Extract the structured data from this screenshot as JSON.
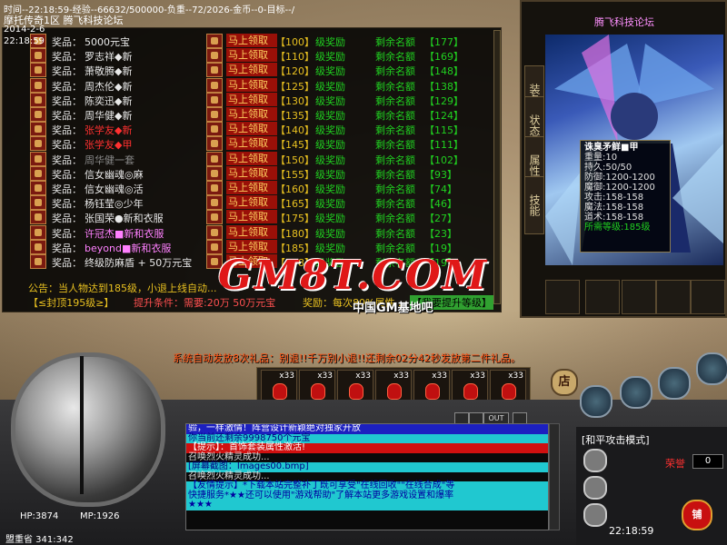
{
  "topbar": {
    "status": "时间--22:18:59-经验--66632/500000-负重--72/2026-金币--0-目标--/",
    "server": "摩托传奇1区 腾飞科技论坛",
    "date": "2014-2-6",
    "time": "22:18:59"
  },
  "reward": {
    "prize_label": "奖品：",
    "claim_label": "马上领取",
    "level_label": "级奖励",
    "remain_label": "剩余名额",
    "rows": [
      {
        "prize": "5000元宝",
        "style": "",
        "level": "【100】",
        "remain": "【177】"
      },
      {
        "prize": "罗志祥◆新",
        "style": "",
        "level": "【110】",
        "remain": "【169】"
      },
      {
        "prize": "萧敬腾◆新",
        "style": "",
        "level": "【120】",
        "remain": "【148】"
      },
      {
        "prize": "周杰伦◆新",
        "style": "",
        "level": "【125】",
        "remain": "【138】"
      },
      {
        "prize": "陈奕迅◆新",
        "style": "",
        "level": "【130】",
        "remain": "【129】"
      },
      {
        "prize": "周华健◆新",
        "style": "",
        "level": "【135】",
        "remain": "【124】"
      },
      {
        "prize": "张学友◆新",
        "style": "red",
        "level": "【140】",
        "remain": "【115】"
      },
      {
        "prize": "张学友◆甲",
        "style": "red",
        "level": "【145】",
        "remain": "【111】"
      },
      {
        "prize": "周华健一套",
        "style": "grey",
        "level": "【150】",
        "remain": "【102】"
      },
      {
        "prize": "信女幽魂◎麻",
        "style": "",
        "level": "【155】",
        "remain": "【93】"
      },
      {
        "prize": "信女幽魂◎活",
        "style": "",
        "level": "【160】",
        "remain": "【74】"
      },
      {
        "prize": "杨钰莹◎少年",
        "style": "",
        "level": "【165】",
        "remain": "【46】"
      },
      {
        "prize": "张国荣●新和衣服",
        "style": "",
        "level": "【175】",
        "remain": "【27】"
      },
      {
        "prize": "许冠杰■新和衣服",
        "style": "pink",
        "level": "【180】",
        "remain": "【23】"
      },
      {
        "prize": "beyond■新和衣服",
        "style": "pink",
        "level": "【185】",
        "remain": "【19】"
      },
      {
        "prize": "终级防麻盾 + 50万元宝",
        "style": "",
        "level": "【198】",
        "remain": "【19】"
      }
    ],
    "announce": "公告：当人物达到185级，小退上线自动...",
    "seal_label": "【≤封顶195级≥】",
    "upgrade_condition": "提升条件：需要:20万 50万元宝",
    "bonus": "奖励：每次80%属性...",
    "promote_btn": "【我要提升等级】"
  },
  "watermark": {
    "logo": "GM8T.COM",
    "sub": "中国GM基地吧"
  },
  "character": {
    "title": "腾飞科技论坛",
    "tabs": [
      "装备",
      "状态",
      "属性",
      "技能"
    ],
    "tooltip": {
      "name": "诛臭矛鲜■甲",
      "weight": "重量:10",
      "durability": "持久:50/50",
      "defense": "防御:1200-1200",
      "mdefense": "魔御:1200-1200",
      "attack": "攻击:158-158",
      "magic": "魔法:158-158",
      "tao": "道术:158-158",
      "req": "所需等级:185级"
    }
  },
  "notice": "系统自动发放8次礼品：别退!!千万别小退!!还剩余02分42秒发放第二件礼品。",
  "belt": {
    "count": "x33",
    "bag": "店"
  },
  "hud": {
    "hp": "HP:3874",
    "mp": "MP:1926",
    "map": "盟重省  341:342",
    "out": "OUT"
  },
  "chat": [
    {
      "text": "验，一样激情！阵营设计新颖绝对独家开放",
      "style": "l-blue"
    },
    {
      "text": "你当前还剩余9998750个元宝",
      "style": "l-cyan"
    },
    {
      "text": "【提示】：首饰套装属性激活!",
      "style": "l-red"
    },
    {
      "text": "召唤烈火精灵成功...",
      "style": "l-white"
    },
    {
      "text": "[屏幕截图：Images00.bmp]",
      "style": "l-cyan"
    },
    {
      "text": "召唤烈火精灵成功...",
      "style": "l-white"
    },
    {
      "text": "【友情提示】*下载本站完整补丁既可享受\"在线回收\"\"在线合成\"等",
      "style": "l-cyanplain"
    },
    {
      "text": "快捷服务*★★还可以使用\"游戏帮助\"了解本站更多游戏设置和爆率",
      "style": "l-cyanplain"
    },
    {
      "text": "★★★",
      "style": "l-cyanplain"
    }
  ],
  "right": {
    "attack_mode": "[和平攻击模式]",
    "honor_label": "荣誉",
    "honor_value": "0",
    "clock": "22:18:59",
    "shop": "铺"
  }
}
